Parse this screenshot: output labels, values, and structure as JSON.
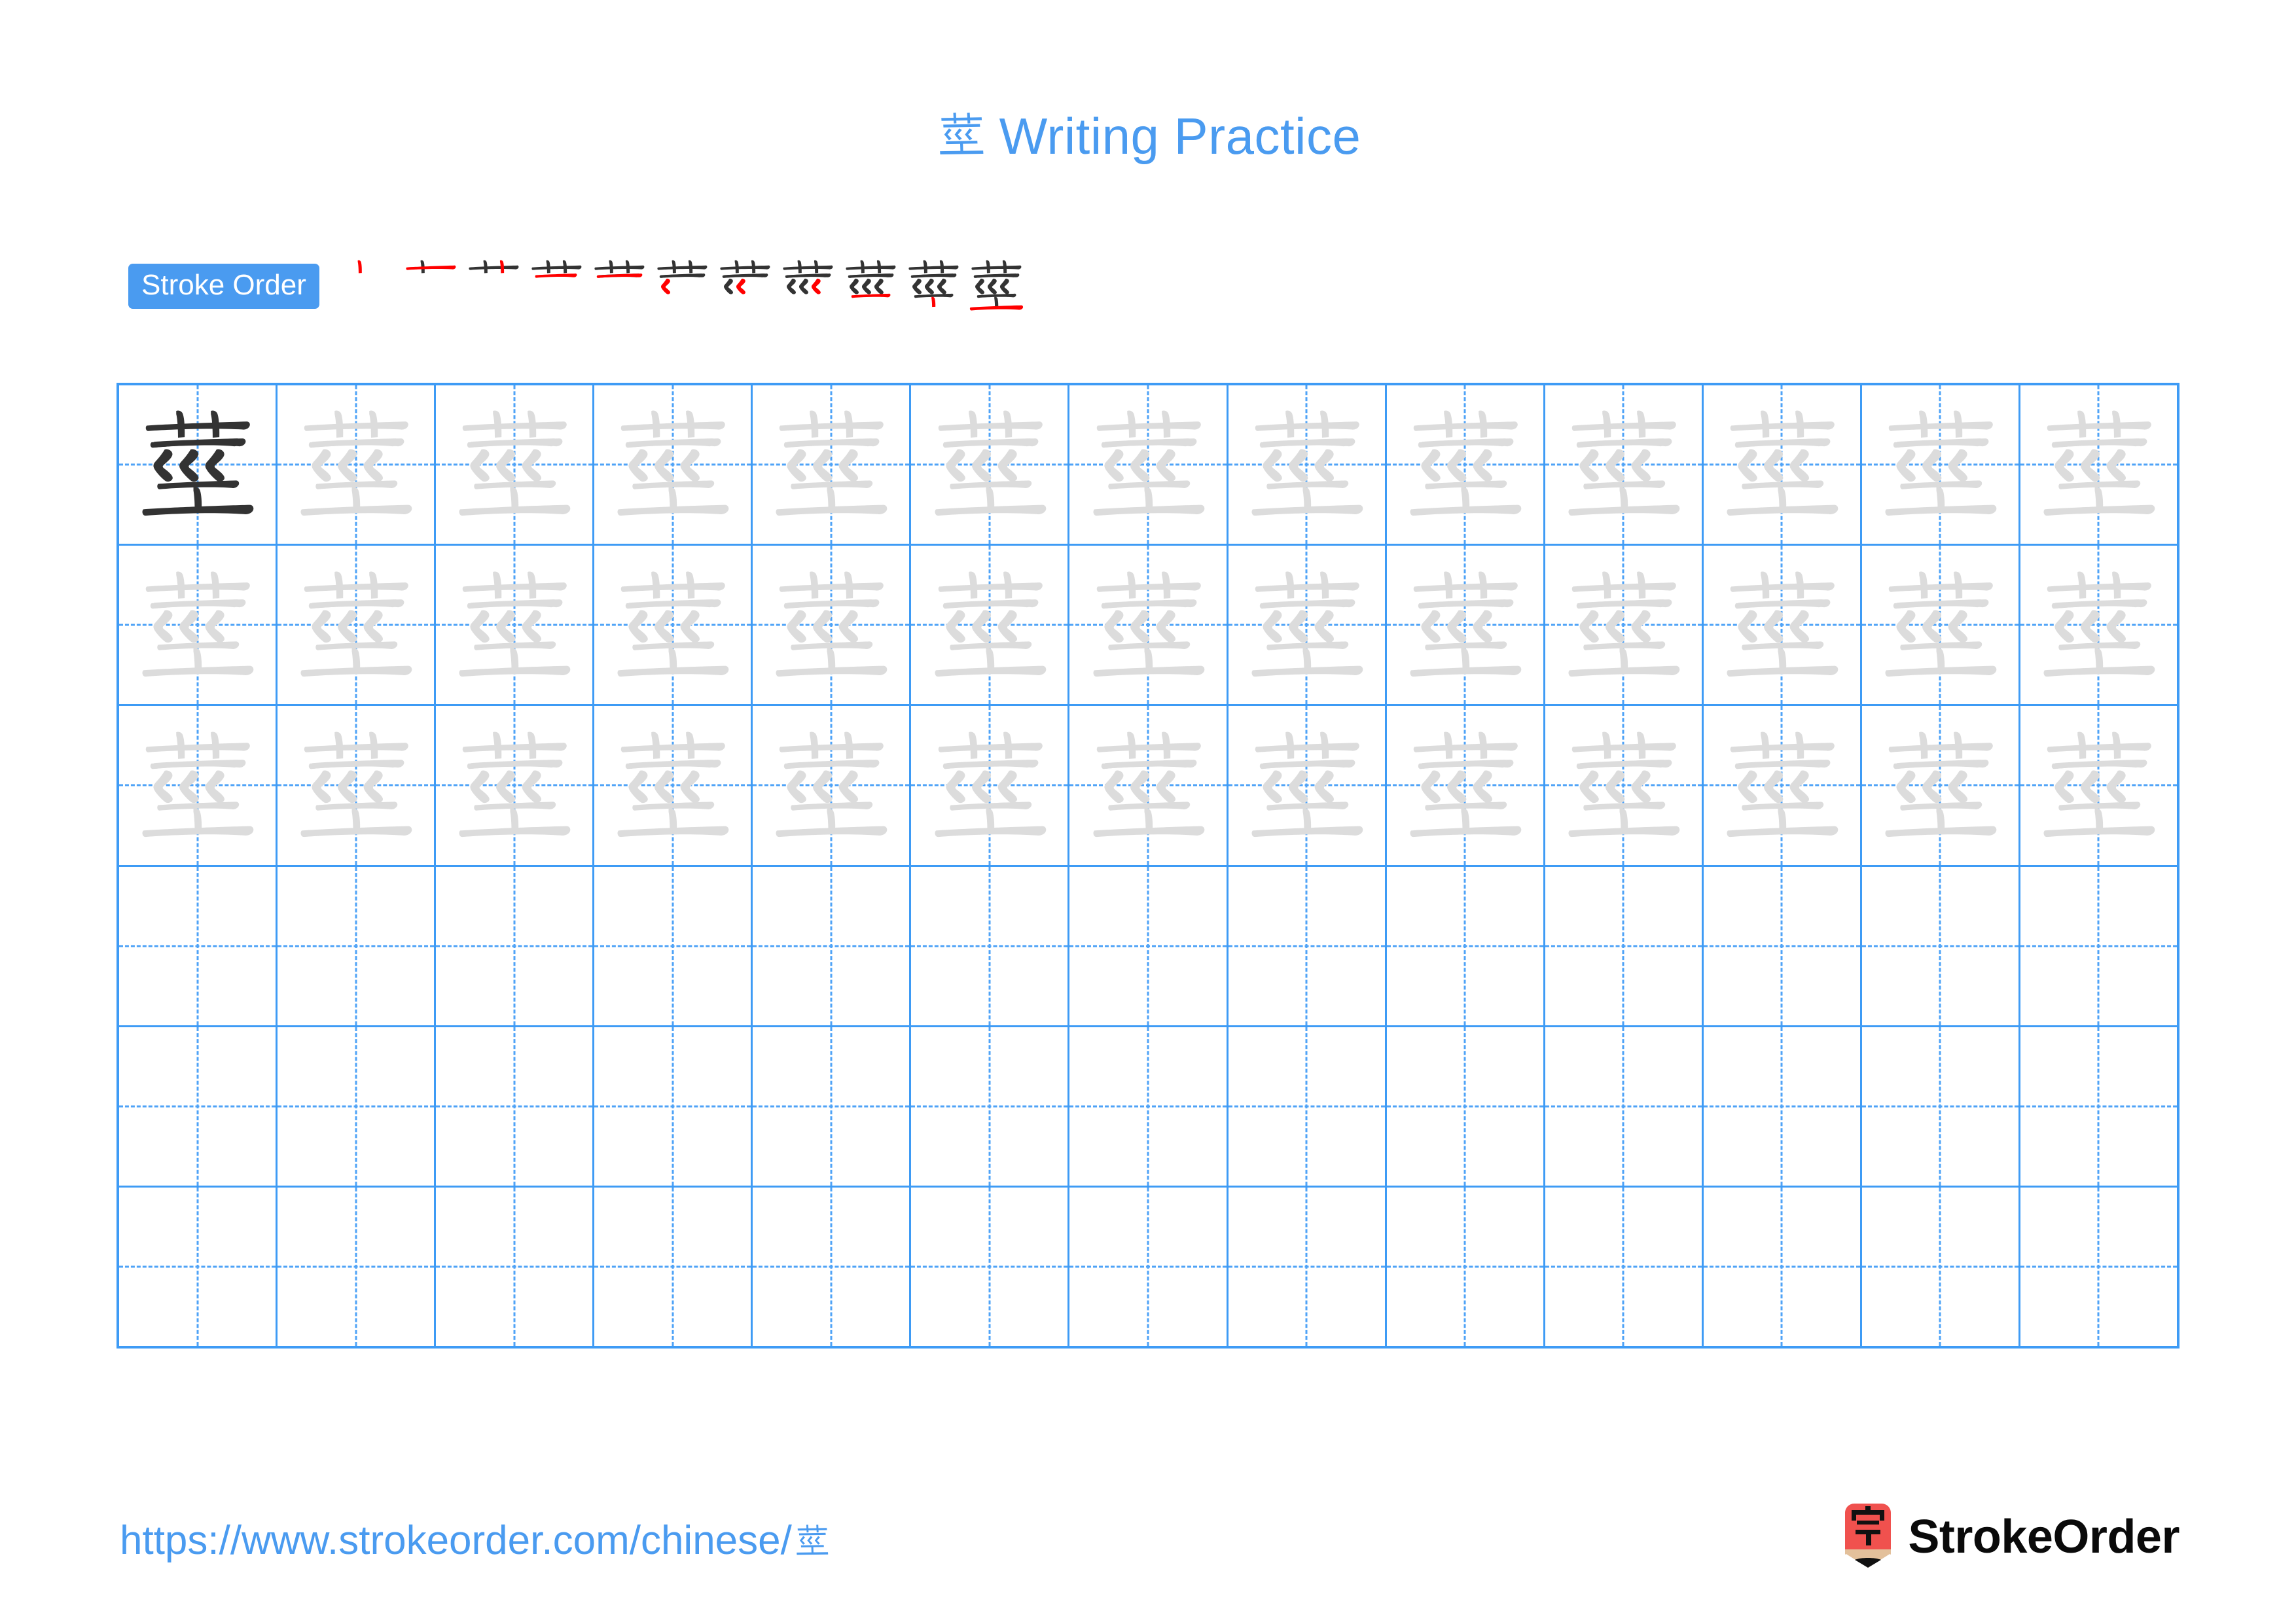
{
  "page": {
    "character": "茎",
    "title_suffix": "Writing Practice",
    "background_color": "#ffffff"
  },
  "header": {
    "title": "茎 Writing Practice",
    "title_color": "#4A9BF0"
  },
  "stroke_order": {
    "badge_label": "Stroke Order",
    "badge_bg": "#4A9BF0",
    "badge_text_color": "#ffffff",
    "total_strokes": 11,
    "new_stroke_color": "#FF0000",
    "existing_stroke_color": "#333333",
    "steps": [
      {
        "index": 1,
        "strokes_shown": 1
      },
      {
        "index": 2,
        "strokes_shown": 2
      },
      {
        "index": 3,
        "strokes_shown": 3
      },
      {
        "index": 4,
        "strokes_shown": 4
      },
      {
        "index": 5,
        "strokes_shown": 5
      },
      {
        "index": 6,
        "strokes_shown": 6
      },
      {
        "index": 7,
        "strokes_shown": 7
      },
      {
        "index": 8,
        "strokes_shown": 8
      },
      {
        "index": 9,
        "strokes_shown": 9
      },
      {
        "index": 10,
        "strokes_shown": 10
      },
      {
        "index": 11,
        "strokes_shown": 11
      }
    ]
  },
  "practice_grid": {
    "columns": 13,
    "rows": 6,
    "grid_line_color": "#3E9BF5",
    "guide_line_color": "#4FA3F7",
    "dark_char_color": "#333333",
    "trace_char_color": "#DCDCDC",
    "row_fill": [
      {
        "row": 1,
        "first_cell": "dark",
        "rest": "trace",
        "filled_cells": 13
      },
      {
        "row": 2,
        "first_cell": "trace",
        "rest": "trace",
        "filled_cells": 13
      },
      {
        "row": 3,
        "first_cell": "trace",
        "rest": "trace",
        "filled_cells": 13
      },
      {
        "row": 4,
        "first_cell": "empty",
        "rest": "empty",
        "filled_cells": 0
      },
      {
        "row": 5,
        "first_cell": "empty",
        "rest": "empty",
        "filled_cells": 0
      },
      {
        "row": 6,
        "first_cell": "empty",
        "rest": "empty",
        "filled_cells": 0
      }
    ]
  },
  "footer": {
    "url_prefix": "https://www.strokeorder.com/chinese/",
    "url_character": "茎",
    "url_color": "#4A9BF0",
    "logo_text": "StrokeOrder",
    "logo_char": "字",
    "logo_body_color": "#F0514E",
    "logo_wood_color": "#E3C09B",
    "logo_tip_color": "#111111",
    "logo_text_color": "#0A0A0A"
  }
}
